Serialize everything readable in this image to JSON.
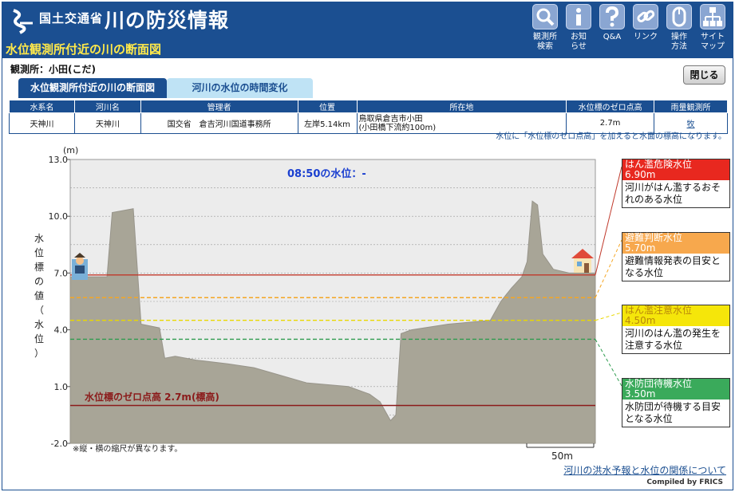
{
  "header": {
    "ministry": "国土交通省",
    "app_title": "川の防災情報",
    "subtitle": "水位観測所付近の川の断面図",
    "nav": [
      {
        "label1": "観測所",
        "label2": "検索",
        "icon": "search-icon"
      },
      {
        "label1": "お知",
        "label2": "らせ",
        "icon": "info-icon"
      },
      {
        "label1": "Q&A",
        "label2": "",
        "icon": "question-icon"
      },
      {
        "label1": "リンク",
        "label2": "",
        "icon": "link-icon"
      },
      {
        "label1": "操作",
        "label2": "方法",
        "icon": "mouse-icon"
      },
      {
        "label1": "サイト",
        "label2": "マップ",
        "icon": "sitemap-icon"
      }
    ]
  },
  "station_label": "観測所：小田(こだ)",
  "close_label": "閉じる",
  "tabs": {
    "section": "水位観測所付近の川の断面図",
    "time": "河川の水位の時間変化"
  },
  "table": {
    "headers": [
      "水系名",
      "河川名",
      "管理者",
      "位置",
      "所在地",
      "水位標のゼロ点高",
      "雨量観測所"
    ],
    "row": {
      "system": "天神川",
      "river": "天神川",
      "manager": "国交省　倉吉河川国道事務所",
      "position": "左岸5.14km",
      "address1": "鳥取県倉吉市小田",
      "address2": "(小田橋下流約100m)",
      "zero_height": "2.7m",
      "rain_station": "牧"
    }
  },
  "note_top": "水位に「水位標のゼロ点高」を加えると水面の標高になります。",
  "chart_data": {
    "type": "area",
    "title": "08:50の水位：-",
    "y_unit": "(m)",
    "y_label": "水位標の値（水位）",
    "y_ticks": [
      "13.0",
      "10.0",
      "7.0",
      "4.0",
      "1.0",
      "-2.0"
    ],
    "ylim": [
      -2.0,
      13.0
    ],
    "zero_point_label": "水位標のゼロ点高 2.7m(標高)",
    "scale_note": "※縦・横の縮尺が異なります。",
    "scale_label": "50m",
    "levels": [
      {
        "name": "はん濫危険水位",
        "value": "6.90m",
        "level": 6.9,
        "color": "#e8281f",
        "line": "#c0392b",
        "desc": "河川がはん濫するおそれのある水位"
      },
      {
        "name": "避難判断水位",
        "value": "5.70m",
        "level": 5.7,
        "color": "#f7a84d",
        "line": "#f5a623",
        "desc": "避難情報発表の目安となる水位"
      },
      {
        "name": "はん濫注意水位",
        "value": "4.50m",
        "level": 4.5,
        "color": "#f5e60a",
        "line": "#e9d800",
        "desc": "河川のはん濫の発生を注意する水位"
      },
      {
        "name": "水防団待機水位",
        "value": "3.50m",
        "level": 3.5,
        "color": "#3aaa5b",
        "line": "#2e9c4f",
        "desc": "水防団が待機する目安となる水位"
      }
    ],
    "profile": [
      [
        0,
        6.8
      ],
      [
        7,
        6.8
      ],
      [
        8,
        10.2
      ],
      [
        12,
        10.4
      ],
      [
        13.5,
        4.3
      ],
      [
        17,
        4.1
      ],
      [
        18,
        2.5
      ],
      [
        20,
        2.6
      ],
      [
        24,
        2.4
      ],
      [
        30,
        2.2
      ],
      [
        35,
        2.0
      ],
      [
        40,
        1.6
      ],
      [
        45,
        1.2
      ],
      [
        53,
        1.0
      ],
      [
        57,
        0.6
      ],
      [
        59,
        0.2
      ],
      [
        60,
        -0.3
      ],
      [
        61,
        -0.8
      ],
      [
        62,
        -0.5
      ],
      [
        63,
        3.8
      ],
      [
        65,
        4.0
      ],
      [
        72,
        4.3
      ],
      [
        80,
        4.5
      ],
      [
        82,
        5.5
      ],
      [
        84,
        6.2
      ],
      [
        86,
        6.8
      ],
      [
        87,
        7.6
      ],
      [
        88,
        10.8
      ],
      [
        89,
        10.6
      ],
      [
        90,
        8.0
      ],
      [
        92,
        7.2
      ],
      [
        95,
        7.0
      ],
      [
        100,
        7.0
      ]
    ]
  },
  "footer_link": "河川の洪水予報と水位の関係について",
  "credit": "Compiled by FRICS"
}
